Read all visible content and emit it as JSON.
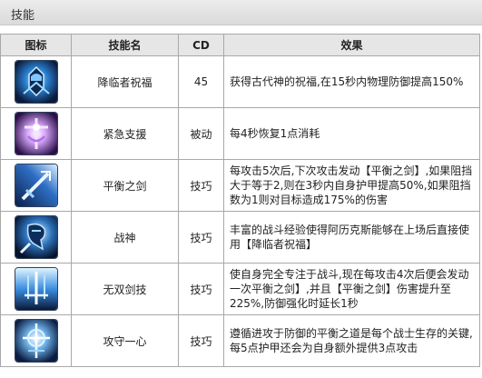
{
  "section": {
    "title": "技能"
  },
  "columns": {
    "icon": "图标",
    "name": "技能名",
    "cd": "CD",
    "effect": "效果"
  },
  "skills": [
    {
      "icon": "blessing-icon",
      "name": "降临者祝福",
      "cd": "45",
      "effect": "获得古代神的祝福,在15秒内物理防御提高150%"
    },
    {
      "icon": "emergency-aid-icon",
      "name": "紧急支援",
      "cd": "被动",
      "effect": "每4秒恢复1点消耗"
    },
    {
      "icon": "sword-of-balance-icon",
      "name": "平衡之剑",
      "cd": "技巧",
      "effect": "每攻击5次后,下次攻击发动【平衡之剑】,如果阻挡大于等于2,则在3秒内自身护甲提高50%,如果阻挡数为1则对目标造成175%的伤害"
    },
    {
      "icon": "war-god-icon",
      "name": "战神",
      "cd": "技巧",
      "effect": "丰富的战斗经验使得阿历克斯能够在上场后直接使用【降临者祝福】"
    },
    {
      "icon": "peerless-sword-icon",
      "name": "无双剑技",
      "cd": "技巧",
      "effect": "使自身完全专注于战斗,现在每攻击4次后便会发动一次平衡之剑】,并且【平衡之剑】伤害提升至225%,防御强化时延长1秒"
    },
    {
      "icon": "attack-defense-icon",
      "name": "攻守一心",
      "cd": "技巧",
      "effect": "遵循进攻于防御的平衡之道是每个战士生存的关键,每5点护甲还会为自身额外提供3点攻击"
    }
  ]
}
